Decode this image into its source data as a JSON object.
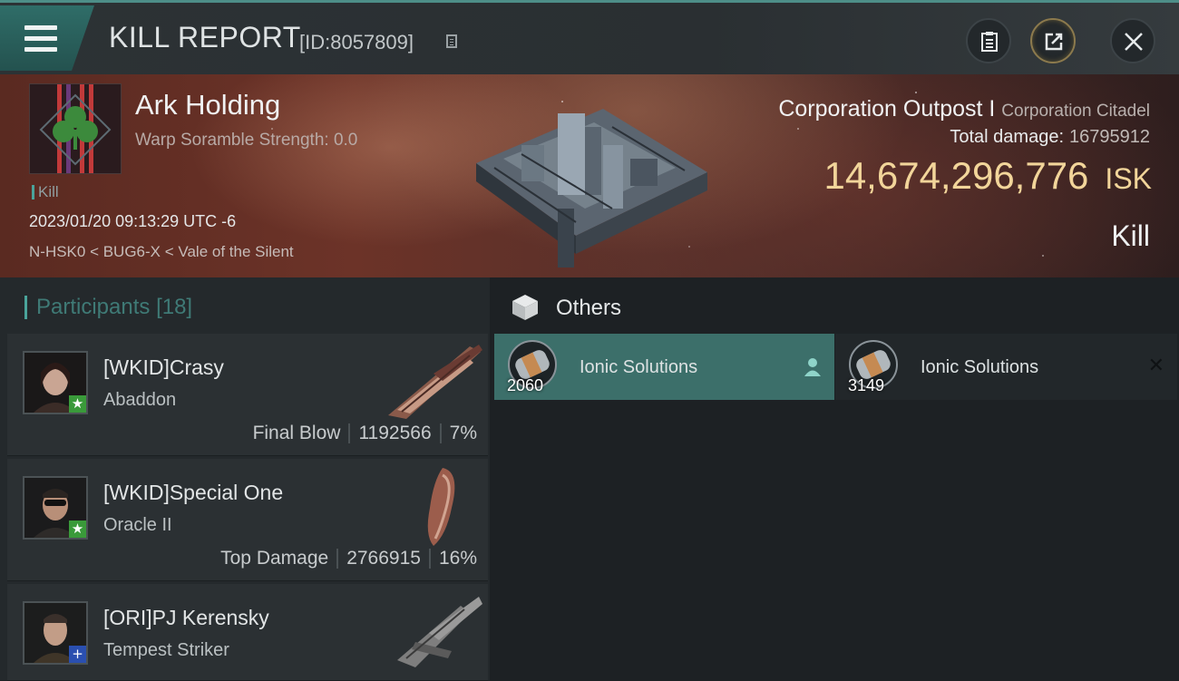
{
  "header": {
    "title": "KILL REPORT",
    "report_id": "[ID:8057809]"
  },
  "victim": {
    "corp_name": "Ark Holding",
    "warp_scramble": "Warp Soramble Strength: 0.0",
    "kill_tag": "Kill",
    "datetime": "2023/01/20 09:13:29 UTC -6",
    "location": "N-HSK0 < BUG6-X < Vale of the Silent",
    "ship_type": "Corporation Outpost I",
    "ship_class": "Corporation Citadel",
    "total_damage_label": "Total damage:",
    "total_damage": "16795912",
    "isk_value": "14,674,296,776",
    "isk_unit": "ISK",
    "result": "Kill"
  },
  "participants": {
    "label": "Participants",
    "count": "[18]",
    "rows": [
      {
        "name": "[WKID]Crasy",
        "ship": "Abaddon",
        "role": "Final Blow",
        "damage": "1192566",
        "percent": "7%",
        "badge": "star"
      },
      {
        "name": "[WKID]Special One",
        "ship": "Oracle II",
        "role": "Top Damage",
        "damage": "2766915",
        "percent": "16%",
        "badge": "star"
      },
      {
        "name": "[ORI]PJ Kerensky",
        "ship": "Tempest Striker",
        "role": "",
        "damage": "",
        "percent": "",
        "badge": "plus"
      }
    ]
  },
  "others": {
    "title": "Others",
    "items": [
      {
        "name": "Ionic Solutions",
        "qty": "2060"
      },
      {
        "name": "Ionic Solutions",
        "qty": "3149"
      }
    ]
  },
  "colors": {
    "accent": "#4aa49b",
    "isk": "#f2d59a",
    "selected_card": "#3c6f6a",
    "star_badge": "#3a9a3a",
    "plus_badge": "#2a4fb0"
  }
}
